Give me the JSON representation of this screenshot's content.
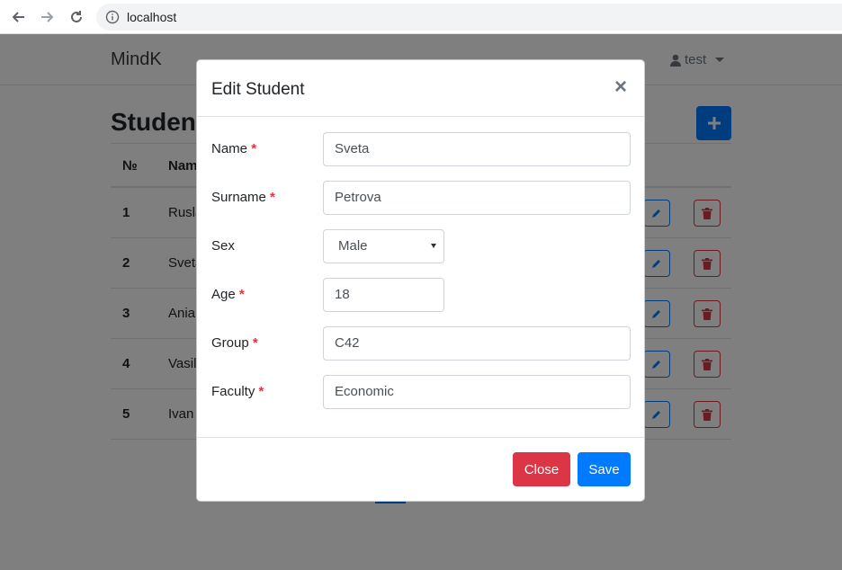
{
  "browser": {
    "url": "localhost"
  },
  "navbar": {
    "brand": "MindK",
    "user": "test"
  },
  "page": {
    "title": "Students",
    "columns": {
      "num": "№",
      "name": "Name"
    },
    "rows": [
      {
        "num": "1",
        "name": "Ruslan"
      },
      {
        "num": "2",
        "name": "Sveta"
      },
      {
        "num": "3",
        "name": "Ania"
      },
      {
        "num": "4",
        "name": "Vasil"
      },
      {
        "num": "5",
        "name": "Ivan"
      }
    ]
  },
  "modal": {
    "title": "Edit Student",
    "close_symbol": "×",
    "required_marker": "*",
    "fields": {
      "name": {
        "label": "Name",
        "value": "Sveta"
      },
      "surname": {
        "label": "Surname",
        "value": "Petrova"
      },
      "sex": {
        "label": "Sex",
        "value": "Male"
      },
      "age": {
        "label": "Age",
        "value": "18"
      },
      "group": {
        "label": "Group",
        "value": "C42"
      },
      "faculty": {
        "label": "Faculty",
        "value": "Economic"
      }
    },
    "close_label": "Close",
    "save_label": "Save"
  },
  "colors": {
    "primary": "#007bff",
    "danger": "#dc3545"
  }
}
